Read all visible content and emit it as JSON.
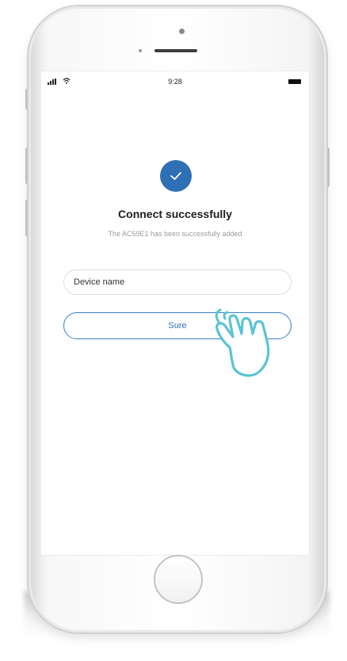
{
  "status_bar": {
    "time": "9:28"
  },
  "result": {
    "icon": "check-icon",
    "title": "Connect successfully",
    "message": "The AC59E1 has been successfully added"
  },
  "form": {
    "device_name_value": "Device name",
    "confirm_label": "Sure"
  },
  "colors": {
    "accent": "#2f6fb5",
    "hint_hand": "#5bc3d6"
  }
}
